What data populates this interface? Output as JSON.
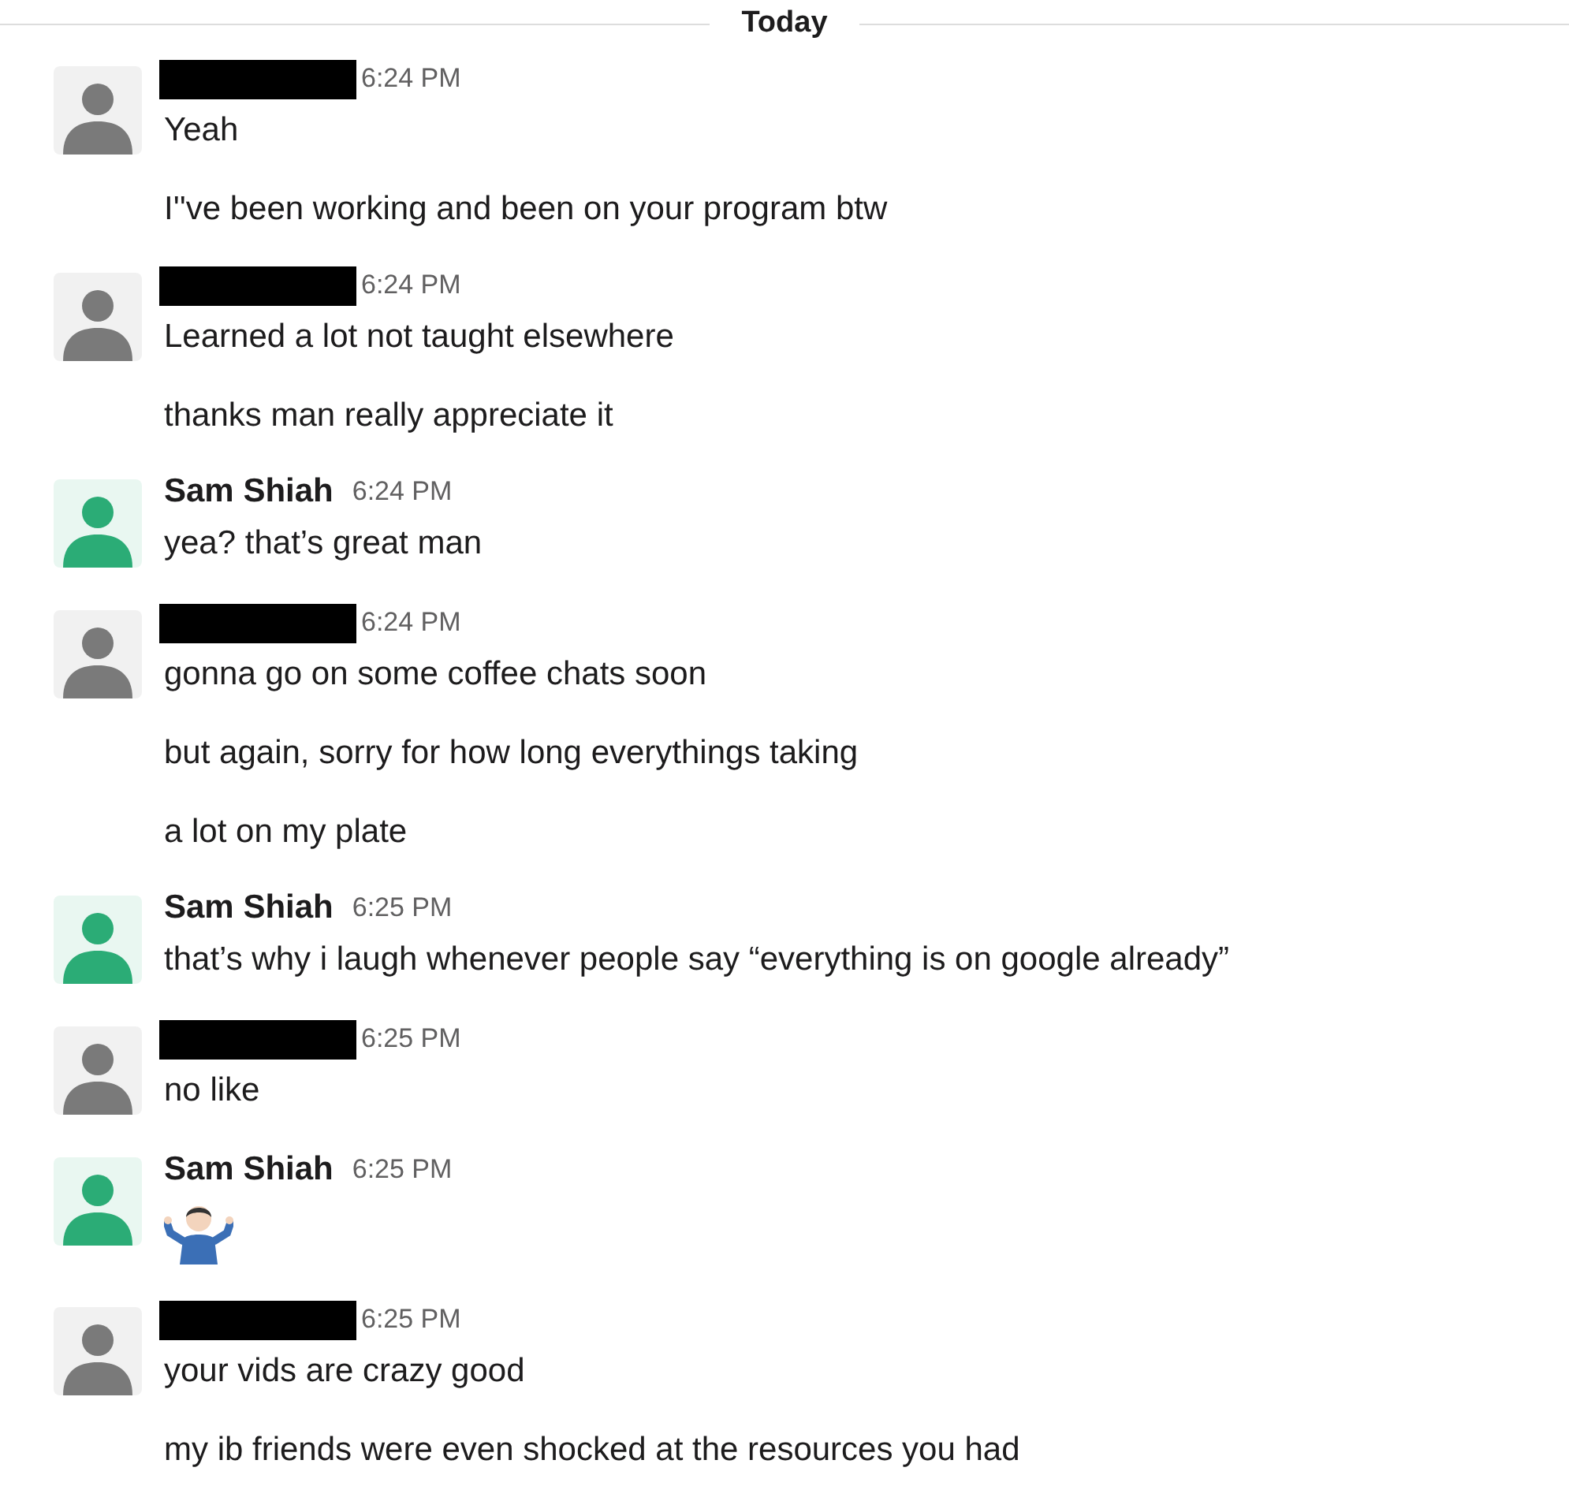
{
  "divider": {
    "label": "Today"
  },
  "messages": [
    {
      "author": {
        "kind": "redacted"
      },
      "avatar": {
        "color": "#7a7a7a"
      },
      "time": "6:24 PM",
      "lines": [
        {
          "kind": "text",
          "text": "Yeah"
        },
        {
          "kind": "text",
          "text": "I''ve been working and been on your program btw"
        }
      ]
    },
    {
      "author": {
        "kind": "redacted"
      },
      "avatar": {
        "color": "#7a7a7a"
      },
      "time": "6:24 PM",
      "lines": [
        {
          "kind": "text",
          "text": "Learned a lot not taught elsewhere"
        },
        {
          "kind": "text",
          "text": "thanks man really appreciate it"
        }
      ]
    },
    {
      "author": {
        "kind": "named",
        "name": "Sam Shiah"
      },
      "avatar": {
        "color": "#2bac76"
      },
      "time": "6:24 PM",
      "lines": [
        {
          "kind": "text",
          "text": "yea? that’s great man"
        }
      ]
    },
    {
      "author": {
        "kind": "redacted"
      },
      "avatar": {
        "color": "#7a7a7a"
      },
      "time": "6:24 PM",
      "lines": [
        {
          "kind": "text",
          "text": "gonna go on some coffee chats soon"
        },
        {
          "kind": "text",
          "text": "but again, sorry for how long everythings taking"
        },
        {
          "kind": "text",
          "text": "a lot on my plate"
        }
      ]
    },
    {
      "author": {
        "kind": "named",
        "name": "Sam Shiah"
      },
      "avatar": {
        "color": "#2bac76"
      },
      "time": "6:25 PM",
      "lines": [
        {
          "kind": "text",
          "text": "that’s why i laugh whenever people say “everything is on google already”"
        }
      ]
    },
    {
      "author": {
        "kind": "redacted"
      },
      "avatar": {
        "color": "#7a7a7a"
      },
      "time": "6:25 PM",
      "lines": [
        {
          "kind": "text",
          "text": "no like"
        }
      ]
    },
    {
      "author": {
        "kind": "named",
        "name": "Sam Shiah"
      },
      "avatar": {
        "color": "#2bac76"
      },
      "time": "6:25 PM",
      "lines": [
        {
          "kind": "shrug"
        }
      ]
    },
    {
      "author": {
        "kind": "redacted"
      },
      "avatar": {
        "color": "#7a7a7a"
      },
      "time": "6:25 PM",
      "lines": [
        {
          "kind": "text",
          "text": "your vids are crazy good"
        },
        {
          "kind": "text",
          "text": "my ib friends were even shocked at the resources you had"
        }
      ]
    }
  ]
}
